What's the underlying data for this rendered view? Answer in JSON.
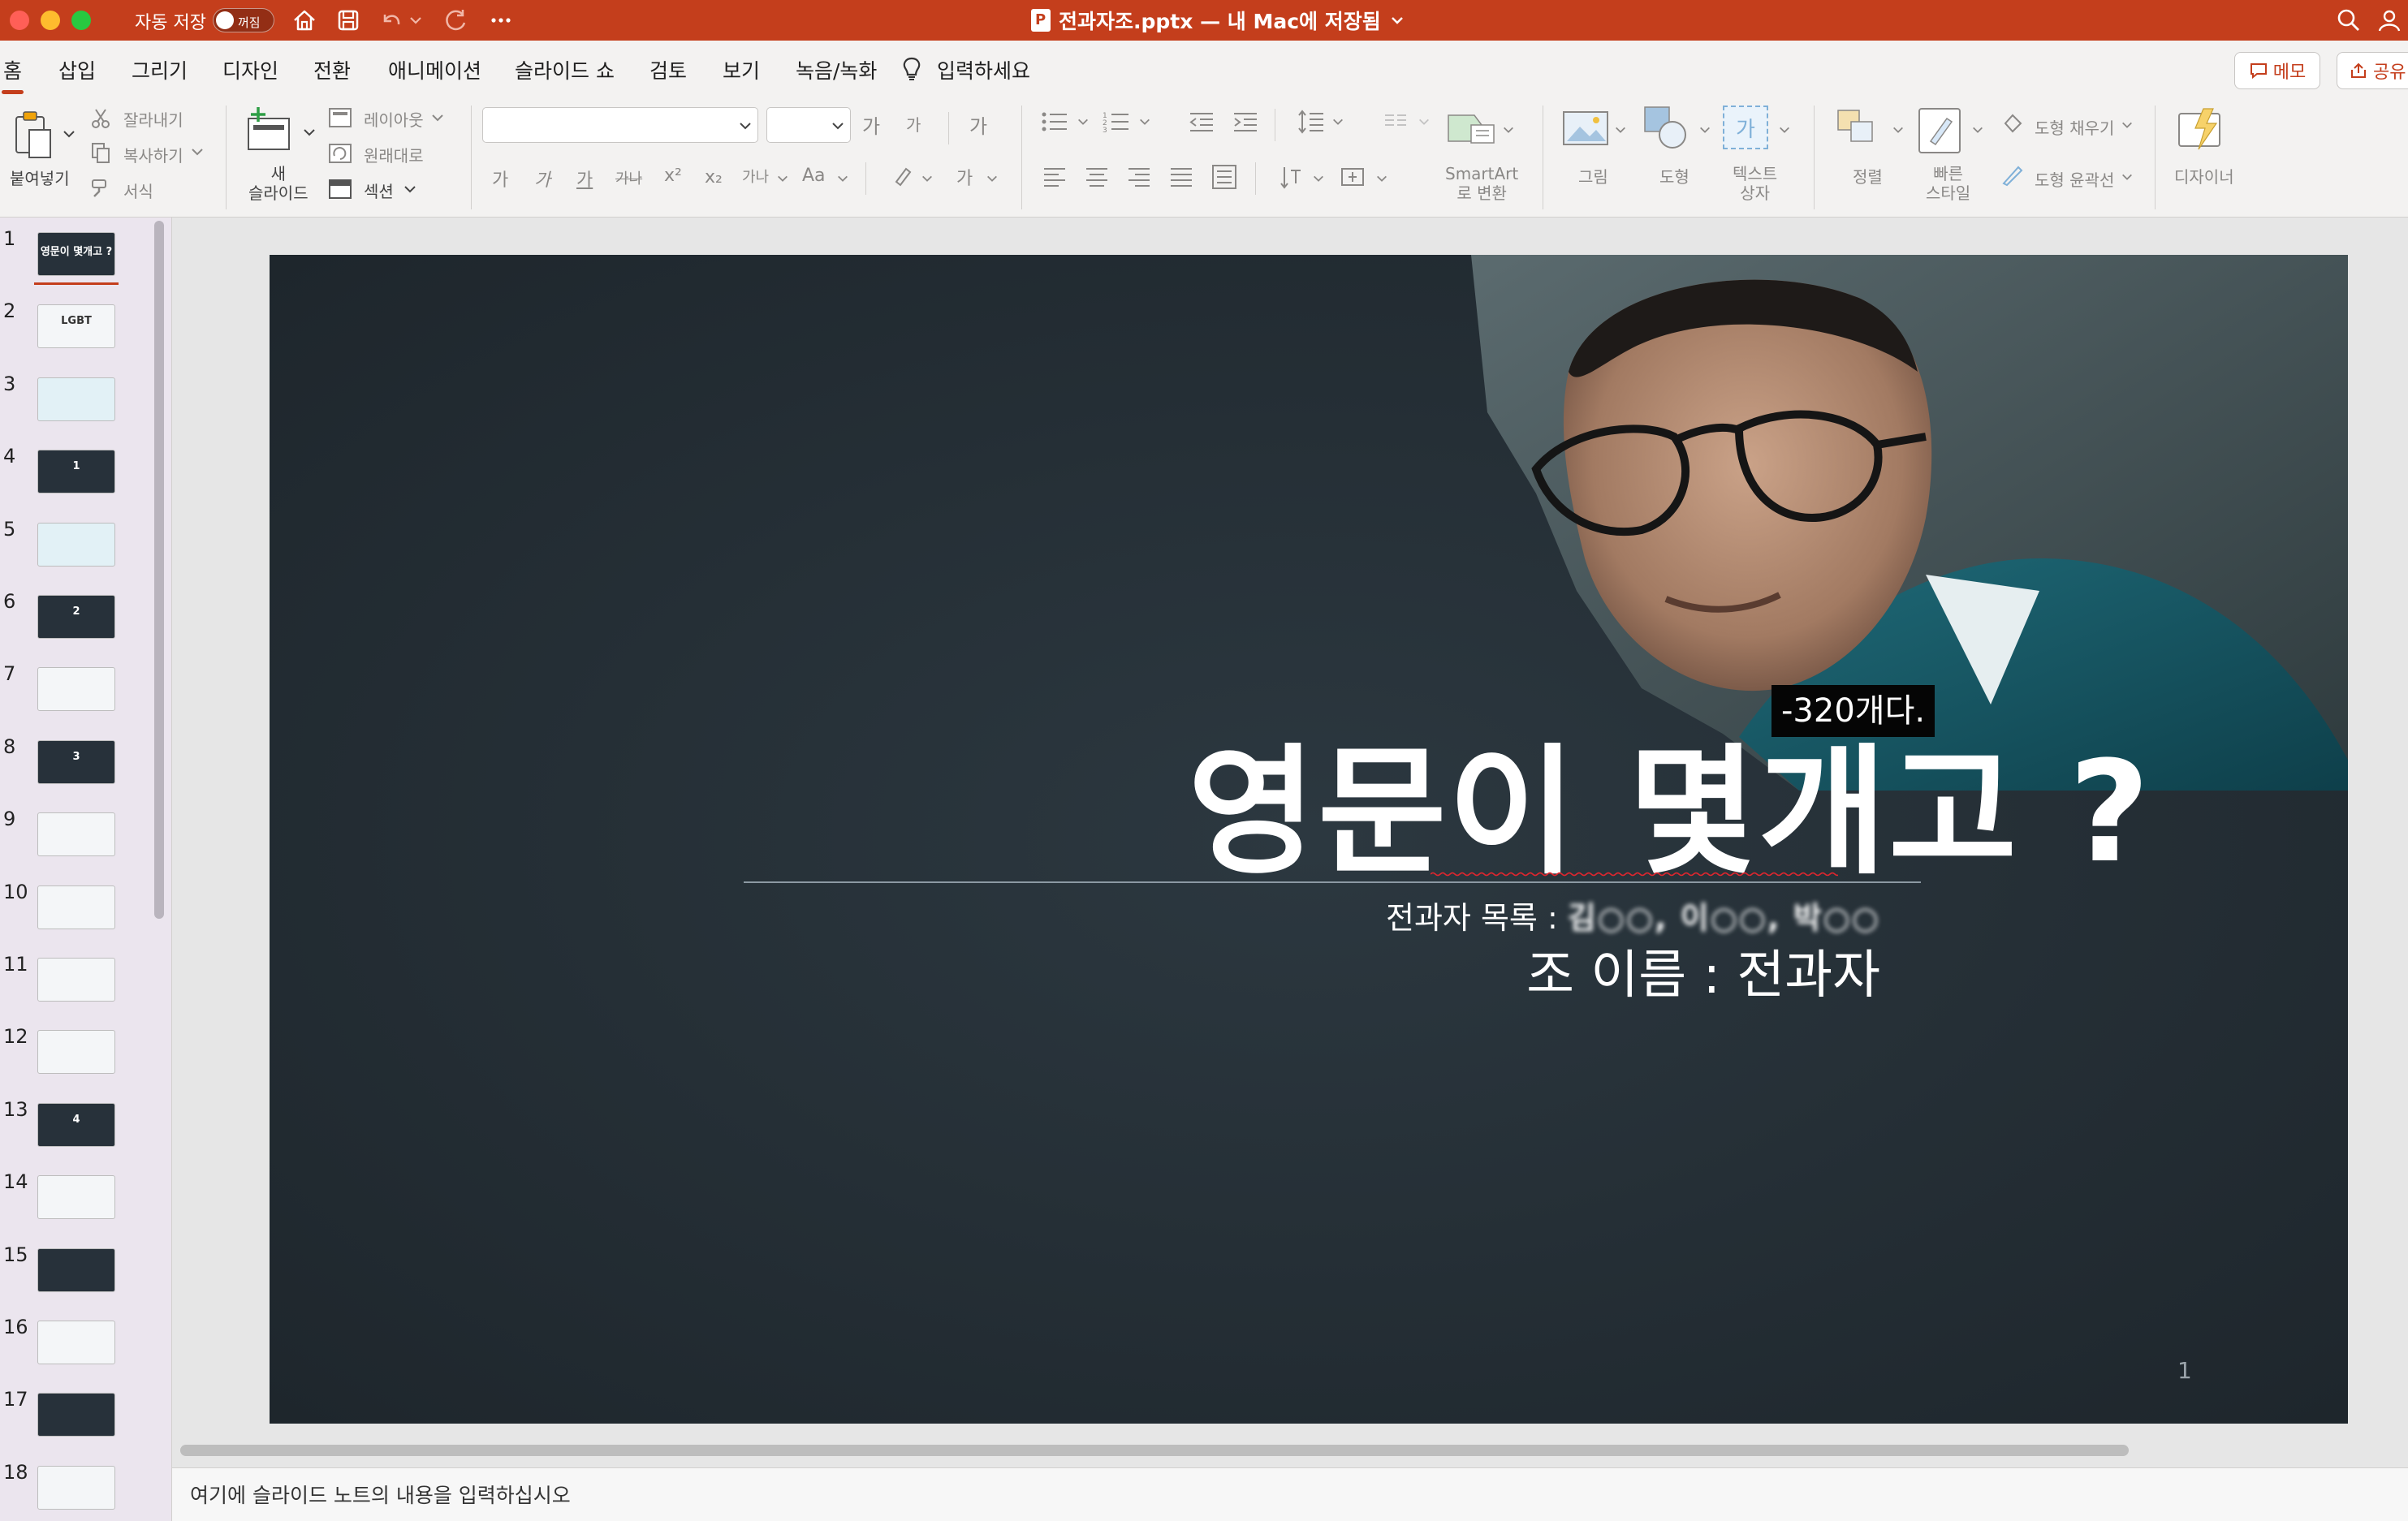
{
  "window": {
    "title": "전과자조.pptx — 내 Mac에 저장됨",
    "autosave_label": "자동 저장",
    "autosave_state": "꺼짐"
  },
  "menu": {
    "tabs": [
      "홈",
      "삽입",
      "그리기",
      "디자인",
      "전환",
      "애니메이션",
      "슬라이드 쇼",
      "검토",
      "보기",
      "녹음/녹화"
    ],
    "search_placeholder": "입력하세요",
    "memo_label": "메모",
    "share_label": "공유"
  },
  "ribbon": {
    "paste": "붙여넣기",
    "cut": "잘라내기",
    "copy": "복사하기",
    "format": "서식",
    "new_slide": "새\n슬라이드",
    "layout": "레이아웃",
    "reset": "원래대로",
    "section": "섹션",
    "font_placeholder": "",
    "size_placeholder": "",
    "grow_font": "가",
    "shrink_font": "가",
    "clear_format": "가",
    "bold": "가",
    "italic": "가",
    "underline": "가",
    "strike": "가나",
    "superscript": "x²",
    "subscript": "x₂",
    "char_spacing": "가나",
    "change_case": "Aa",
    "font_color": "가",
    "smartart": "SmartArt\n로 변환",
    "picture": "그림",
    "shape": "도형",
    "textbox_icon": "가",
    "textbox": "텍스트\n상자",
    "arrange": "정렬",
    "quick_styles": "빠른\n스타일",
    "shape_fill": "도형 채우기",
    "shape_outline": "도형 윤곽선",
    "designer": "디자이너"
  },
  "slides": [
    {
      "num": "1",
      "style": "dark",
      "label": "영문이 몇개고 ?"
    },
    {
      "num": "2",
      "style": "light",
      "label": "LGBT"
    },
    {
      "num": "3",
      "style": "cyan",
      "label": ""
    },
    {
      "num": "4",
      "style": "dark",
      "label": "1"
    },
    {
      "num": "5",
      "style": "cyan",
      "label": ""
    },
    {
      "num": "6",
      "style": "dark",
      "label": "2"
    },
    {
      "num": "7",
      "style": "light",
      "label": ""
    },
    {
      "num": "8",
      "style": "dark",
      "label": "3"
    },
    {
      "num": "9",
      "style": "light",
      "label": ""
    },
    {
      "num": "10",
      "style": "light",
      "label": ""
    },
    {
      "num": "11",
      "style": "light",
      "label": ""
    },
    {
      "num": "12",
      "style": "light",
      "label": ""
    },
    {
      "num": "13",
      "style": "dark",
      "label": "4"
    },
    {
      "num": "14",
      "style": "light",
      "label": ""
    },
    {
      "num": "15",
      "style": "dark",
      "label": ""
    },
    {
      "num": "16",
      "style": "light",
      "label": ""
    },
    {
      "num": "17",
      "style": "dark",
      "label": ""
    },
    {
      "num": "18",
      "style": "light",
      "label": ""
    }
  ],
  "current_slide": {
    "title": "영문이 몇개고 ?",
    "members_label": "전과자 목록 : ",
    "members_redacted": "김○○, 이○○, 박○○",
    "team_line": "조 이름 : 전과자",
    "photo_caption": "-320개다.",
    "slide_number": "1"
  },
  "notes_placeholder": "여기에 슬라이드 노트의 내용을 입력하십시오",
  "colors": {
    "accent": "#c43e1c",
    "slide_bg": "#222c33",
    "panel_bg": "#ebe5ee"
  }
}
